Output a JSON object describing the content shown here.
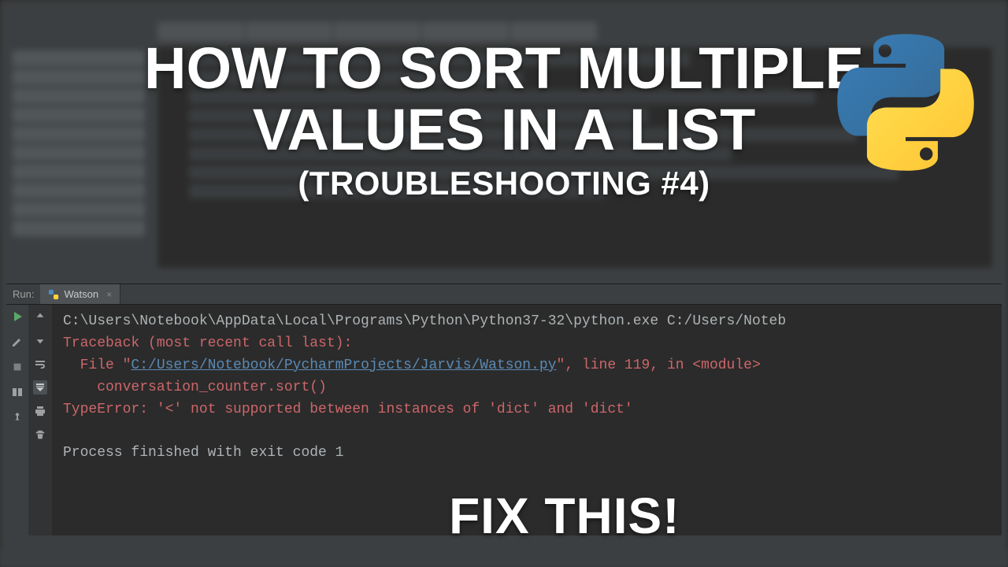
{
  "overlay": {
    "title_line1": "HOW TO SORT MULTIPLE",
    "title_line2": "VALUES IN A LIST",
    "subtitle": "(TROUBLESHOOTING #4)",
    "fix_this": "FIX THIS!"
  },
  "run_panel": {
    "label": "Run:",
    "tab_name": "Watson",
    "close_tooltip": "Close Tab"
  },
  "console": {
    "cmd": "C:\\Users\\Notebook\\AppData\\Local\\Programs\\Python\\Python37-32\\python.exe C:/Users/Noteb",
    "trace_header": "Traceback (most recent call last):",
    "file_prefix": "  File \"",
    "file_link": "C:/Users/Notebook/PycharmProjects/Jarvis/Watson.py",
    "file_suffix": "\", line 119, in <module>",
    "code_line": "    conversation_counter.sort()",
    "error_line": "TypeError: '<' not supported between instances of 'dict' and 'dict'",
    "exit_line": "Process finished with exit code 1"
  },
  "icons": {
    "python": "python-logo-icon",
    "play": "play-icon",
    "wrench": "wrench-icon",
    "stop": "stop-icon",
    "layout": "layout-icon",
    "pin": "pin-icon",
    "up": "arrow-up-icon",
    "down": "arrow-down-icon",
    "wrap": "soft-wrap-icon",
    "scroll": "scroll-to-end-icon",
    "print": "print-icon",
    "trash": "trash-icon"
  }
}
